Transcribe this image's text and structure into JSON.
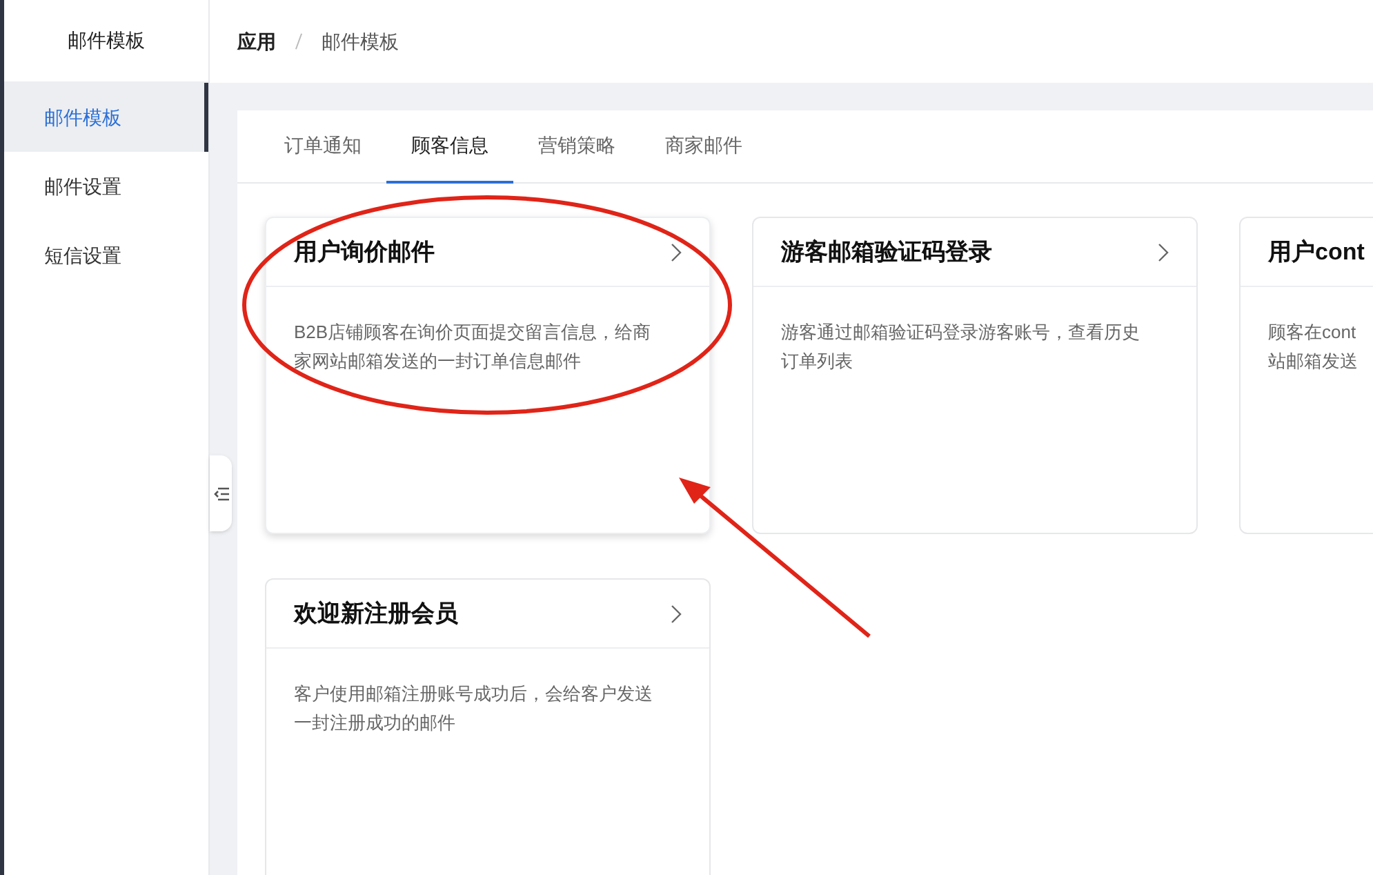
{
  "sidebar": {
    "title": "邮件模板",
    "items": [
      {
        "label": "邮件模板",
        "selected": true
      },
      {
        "label": "邮件设置",
        "selected": false
      },
      {
        "label": "短信设置",
        "selected": false
      }
    ]
  },
  "breadcrumb": [
    "应用",
    "邮件模板"
  ],
  "tabs": [
    {
      "label": "订单通知",
      "selected": false
    },
    {
      "label": "顾客信息",
      "selected": true
    },
    {
      "label": "营销策略",
      "selected": false
    },
    {
      "label": "商家邮件",
      "selected": false
    }
  ],
  "cards": [
    {
      "title": "用户询价邮件",
      "description": [
        "B2B店铺顾客在询价页面提交留言信息，给商",
        "家网站邮箱发送的一封订单信息邮件"
      ],
      "highlighted": true
    },
    {
      "title": "游客邮箱验证码登录",
      "description": [
        "游客通过邮箱验证码登录游客账号，查看历史",
        "订单列表"
      ],
      "highlighted": false
    },
    {
      "title": "用户cont",
      "description": [
        "顾客在cont",
        "站邮箱发送"
      ],
      "highlighted": false
    },
    {
      "title": "欢迎新注册会员",
      "description": [
        "客户使用邮箱注册账号成功后，会给客户发送",
        "一封注册成功的邮件"
      ],
      "highlighted": false
    }
  ]
}
